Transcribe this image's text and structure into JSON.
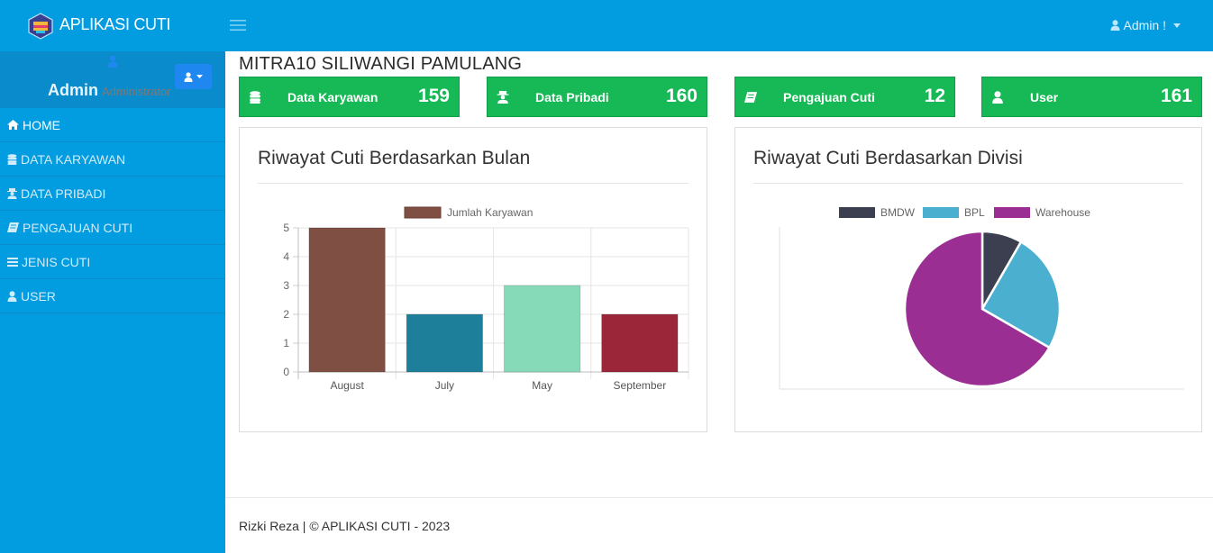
{
  "app": {
    "title": "APLIKASI CUTI"
  },
  "profile": {
    "name": "Admin",
    "role": "Administrator"
  },
  "sidebar": {
    "items": [
      {
        "label": "HOME",
        "icon": "home-icon"
      },
      {
        "label": "DATA KARYAWAN",
        "icon": "database-icon"
      },
      {
        "label": "DATA PRIBADI",
        "icon": "user-secret-icon"
      },
      {
        "label": "PENGAJUAN CUTI",
        "icon": "book-icon"
      },
      {
        "label": "JENIS CUTI",
        "icon": "list-icon"
      },
      {
        "label": "USER",
        "icon": "user-icon"
      }
    ]
  },
  "topbar": {
    "user_label": "Admin !"
  },
  "page": {
    "title": "MITRA10 SILIWANGI PAMULANG"
  },
  "stats": [
    {
      "label": "Data Karyawan",
      "value": "159",
      "icon": "database-icon"
    },
    {
      "label": "Data Pribadi",
      "value": "160",
      "icon": "user-secret-icon"
    },
    {
      "label": "Pengajuan Cuti",
      "value": "12",
      "icon": "book-icon"
    },
    {
      "label": "User",
      "value": "161",
      "icon": "user-icon"
    }
  ],
  "panels": {
    "bulan_title": "Riwayat Cuti Berdasarkan Bulan",
    "divisi_title": "Riwayat Cuti Berdasarkan Divisi"
  },
  "colors": {
    "primary": "#029ce0",
    "stat_green": "#16b956",
    "profile_button": "#1e88f0"
  },
  "chart_data": [
    {
      "type": "bar",
      "title": "Riwayat Cuti Berdasarkan Bulan",
      "legend": [
        "Jumlah Karyawan"
      ],
      "legend_position": "top",
      "categories": [
        "August",
        "July",
        "May",
        "September"
      ],
      "series": [
        {
          "name": "Jumlah Karyawan",
          "values": [
            5,
            2,
            3,
            2
          ]
        }
      ],
      "bar_colors": [
        "#7f4f43",
        "#1e7f9b",
        "#86dab8",
        "#9c2639"
      ],
      "ylim": [
        0,
        5
      ],
      "yticks": [
        "0",
        "1",
        "2",
        "3",
        "4",
        "5"
      ],
      "grid": true
    },
    {
      "type": "pie",
      "title": "Riwayat Cuti Berdasarkan Divisi",
      "legend_position": "top",
      "labels": [
        "BMDW",
        "BPL",
        "Warehouse"
      ],
      "values": [
        1,
        3,
        8
      ],
      "colors": [
        "#3b3f4f",
        "#4bb0d0",
        "#9b2e92"
      ]
    }
  ]
}
